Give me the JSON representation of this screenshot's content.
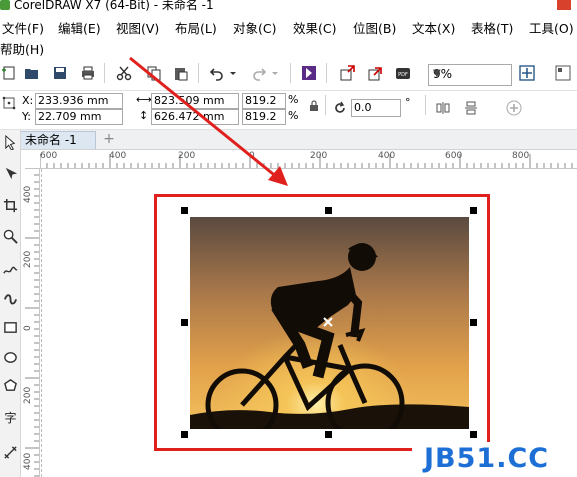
{
  "window": {
    "title": "CorelDRAW X7 (64-Bit) - 未命名 -1"
  },
  "menubar": {
    "items": [
      "文件(F)",
      "编辑(E)",
      "视图(V)",
      "布局(L)",
      "对象(C)",
      "效果(C)",
      "位图(B)",
      "文本(X)",
      "表格(T)",
      "工具(O)"
    ],
    "help": "帮助(H)"
  },
  "toolbar": {
    "icons": [
      "new-icon",
      "open-icon",
      "save-icon",
      "print-icon",
      "cut-icon",
      "copy-icon",
      "paste-icon",
      "undo-icon",
      "redo-icon",
      "corel-connect-icon",
      "import-icon",
      "export-icon",
      "pdf-icon",
      "zoom-fit-icon",
      "options-icon"
    ],
    "zoom_level": "9%"
  },
  "property_bar": {
    "x_label": "X:",
    "x_value": "233.936 mm",
    "y_label": "Y:",
    "y_value": "22.709 mm",
    "width_value": "823.509 mm",
    "height_value": "626.472 mm",
    "scale_x": "819.2",
    "scale_y": "819.2",
    "percent_sign": "%",
    "rotation_value": "0.0",
    "degree_sign": "°"
  },
  "tabs": {
    "document_tab": "未命名 -1",
    "add_tab": "+"
  },
  "ruler": {
    "horizontal_labels": [
      "600",
      "400",
      "200",
      "0",
      "200",
      "400",
      "600",
      "800"
    ],
    "vertical_labels": [
      "400",
      "200",
      "0",
      "200",
      "400"
    ]
  },
  "watermark": {
    "text": "JB51.CC"
  },
  "colors": {
    "highlight": "#e0201d",
    "arrow": "#e0201d",
    "watermark": "#1d6fd6",
    "tab_active": "#dce7f1"
  }
}
